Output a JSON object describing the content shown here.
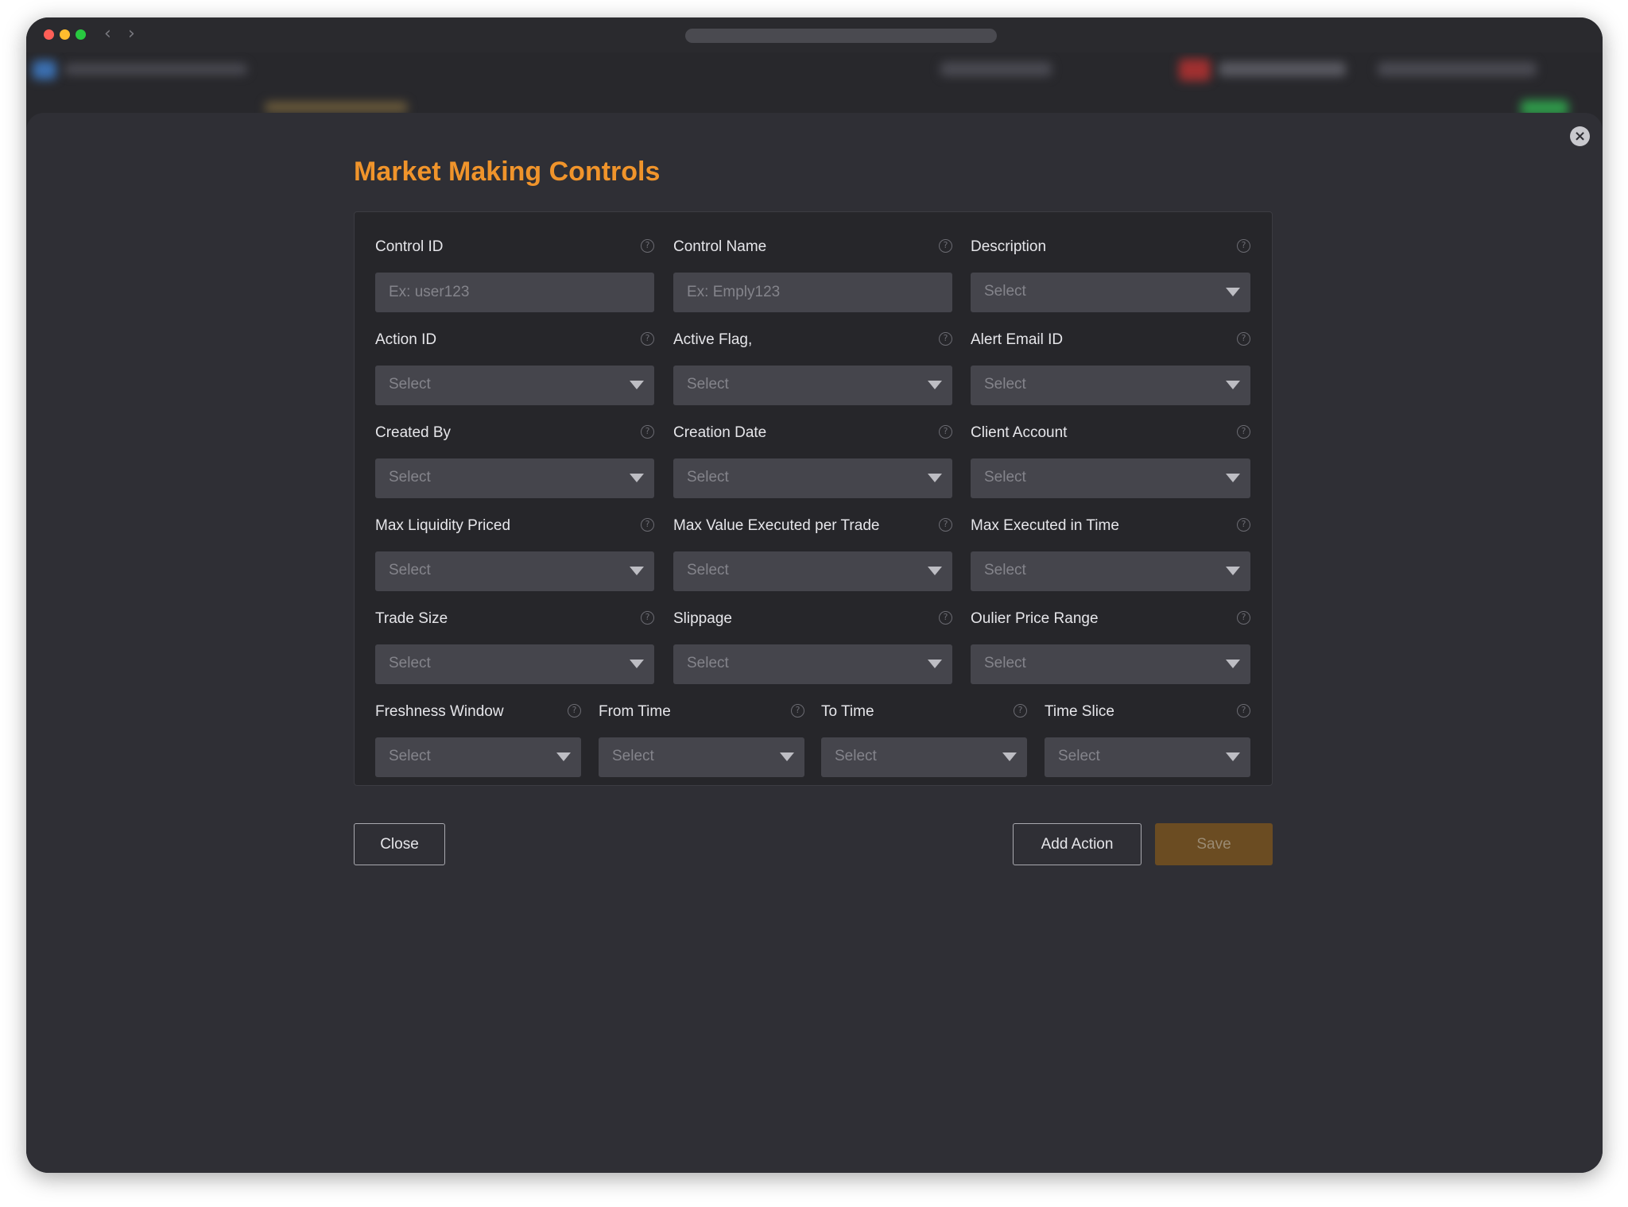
{
  "modal": {
    "title": "Market Making Controls",
    "close_glyph": "×"
  },
  "fields": {
    "control_id": {
      "label": "Control ID",
      "placeholder": "Ex: user123"
    },
    "control_name": {
      "label": "Control Name",
      "placeholder": "Ex: Emply123"
    },
    "description": {
      "label": "Description",
      "value": "Select"
    },
    "action_id": {
      "label": "Action ID",
      "value": "Select"
    },
    "active_flag": {
      "label": "Active Flag,",
      "value": "Select"
    },
    "alert_email_id": {
      "label": "Alert Email ID",
      "value": "Select"
    },
    "created_by": {
      "label": "Created By",
      "value": "Select"
    },
    "creation_date": {
      "label": "Creation Date",
      "value": "Select"
    },
    "client_account": {
      "label": "Client Account",
      "value": "Select"
    },
    "max_liquidity_priced": {
      "label": "Max Liquidity Priced",
      "value": "Select"
    },
    "max_value_executed": {
      "label": "Max Value Executed per Trade",
      "value": "Select"
    },
    "max_executed_in_time": {
      "label": "Max Executed in Time",
      "value": "Select"
    },
    "trade_size": {
      "label": "Trade Size",
      "value": "Select"
    },
    "slippage": {
      "label": "Slippage",
      "value": "Select"
    },
    "outlier_price_range": {
      "label": "Oulier Price Range",
      "value": "Select"
    },
    "freshness_window": {
      "label": "Freshness Window",
      "value": "Select"
    },
    "from_time": {
      "label": "From Time",
      "value": "Select"
    },
    "to_time": {
      "label": "To Time",
      "value": "Select"
    },
    "time_slice": {
      "label": "Time Slice",
      "value": "Select"
    }
  },
  "help_glyph": "?",
  "buttons": {
    "close": "Close",
    "add_action": "Add Action",
    "save": "Save"
  },
  "icons": {
    "help": "question-circle-icon",
    "caret": "caret-down-icon",
    "close": "close-icon"
  },
  "colors": {
    "accent": "#f0942b",
    "save_bg": "#6b4c22",
    "modal_bg": "#2f2f35",
    "card_bg": "#26262a",
    "input_bg": "#45454c"
  }
}
